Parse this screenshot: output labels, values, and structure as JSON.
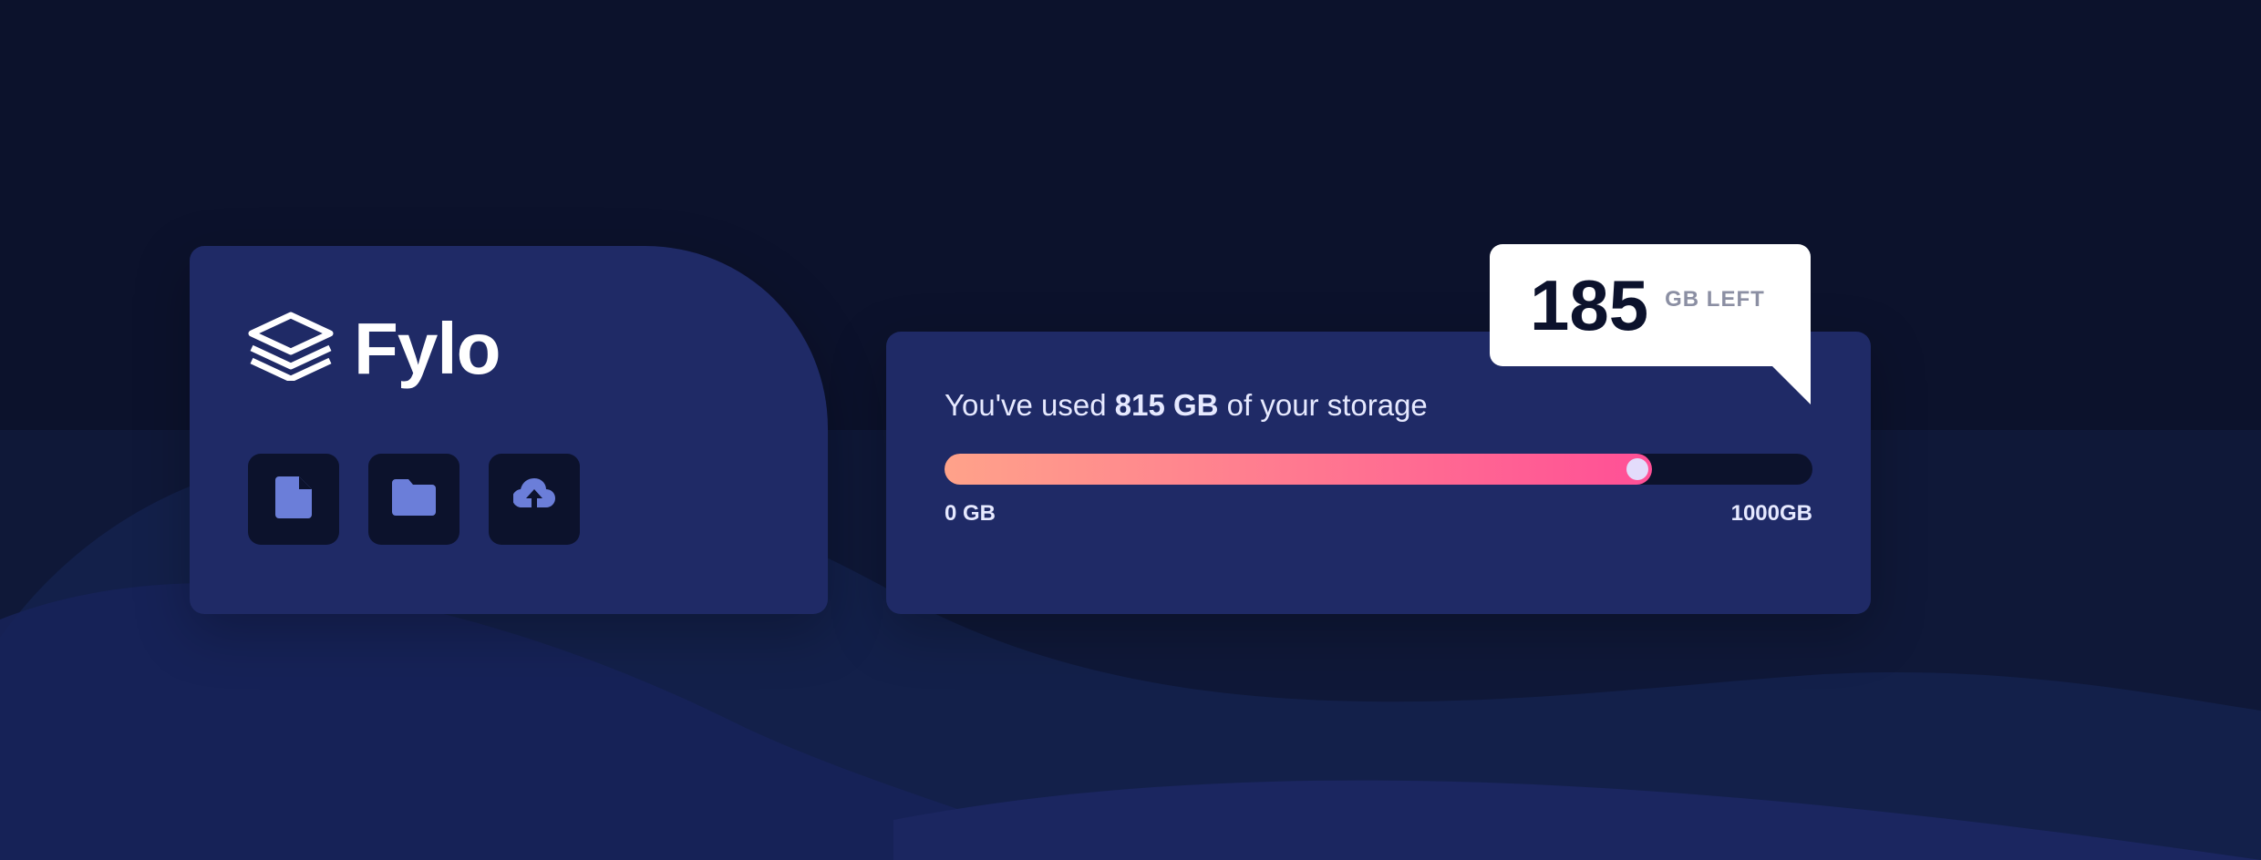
{
  "brand": {
    "name": "Fylo",
    "logo_icon": "stacked-layers-icon"
  },
  "actions": [
    {
      "name": "document-icon"
    },
    {
      "name": "folder-icon"
    },
    {
      "name": "upload-icon"
    }
  ],
  "storage": {
    "usage_prefix": "You've used ",
    "used_amount": "815 GB",
    "usage_suffix": " of your storage",
    "progress_fraction": 0.815,
    "scale_min": "0 GB",
    "scale_max": "1000GB",
    "remaining_value": "185",
    "remaining_unit": "GB LEFT"
  },
  "colors": {
    "background": "#0c122c",
    "card": "#1f2a66",
    "icon_accent": "#6b7ed9",
    "gradient_start": "#ffa28a",
    "gradient_end": "#ff4f96"
  }
}
